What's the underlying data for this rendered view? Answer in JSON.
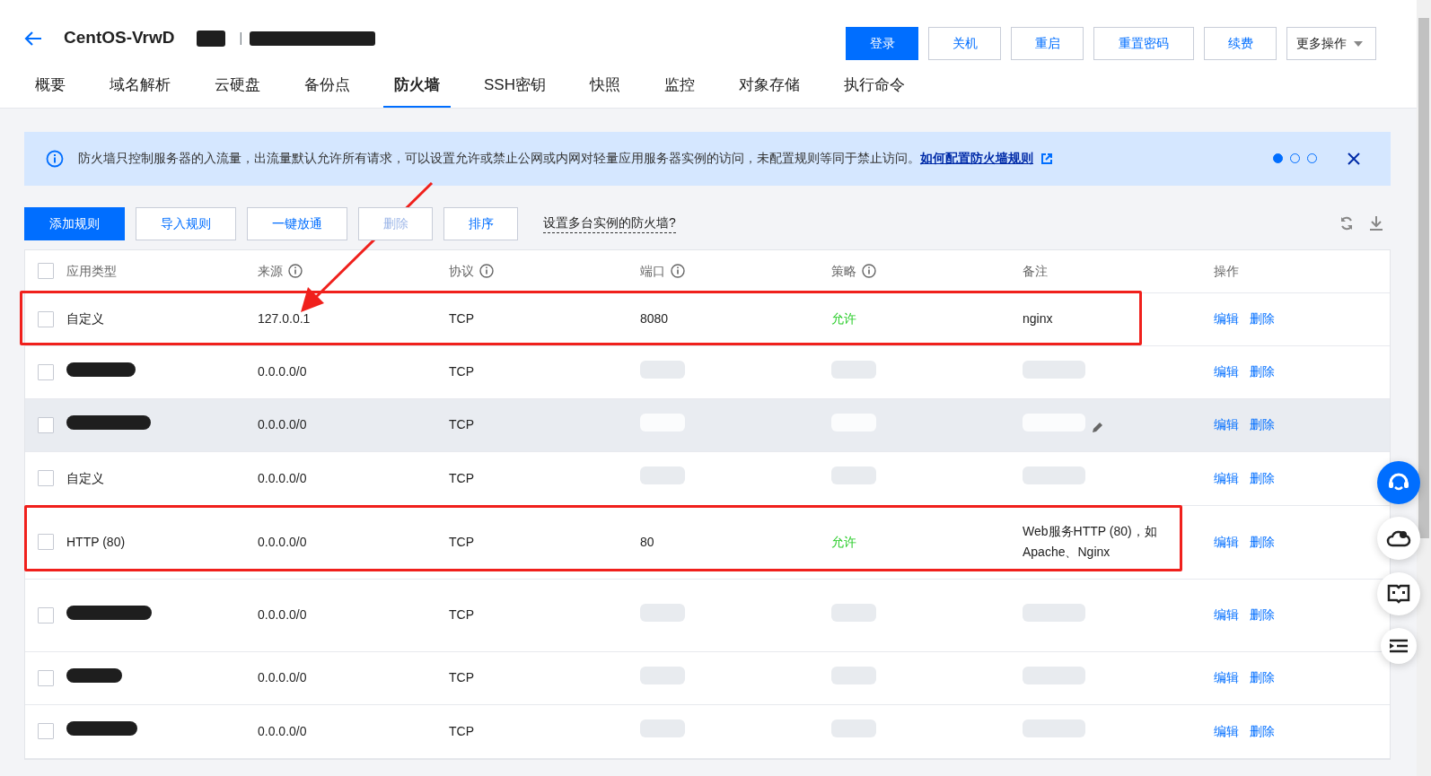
{
  "header": {
    "title": "CentOS-VrwD",
    "separator": "|",
    "name_redacted": true,
    "buttons": [
      {
        "label": "登录",
        "primary": true
      },
      {
        "label": "关机",
        "primary": false
      },
      {
        "label": "重启",
        "primary": false
      },
      {
        "label": "重置密码",
        "primary": false
      },
      {
        "label": "续费",
        "primary": false
      }
    ],
    "more_menu": "更多操作"
  },
  "tabs": [
    {
      "label": "概要",
      "selected": false
    },
    {
      "label": "域名解析",
      "selected": false
    },
    {
      "label": "云硬盘",
      "selected": false
    },
    {
      "label": "备份点",
      "selected": false
    },
    {
      "label": "防火墙",
      "selected": true
    },
    {
      "label": "SSH密钥",
      "selected": false
    },
    {
      "label": "快照",
      "selected": false
    },
    {
      "label": "监控",
      "selected": false
    },
    {
      "label": "对象存储",
      "selected": false
    },
    {
      "label": "执行命令",
      "selected": false
    }
  ],
  "notice": {
    "text": "防火墙只控制服务器的入流量，出流量默认允许所有请求，可以设置允许或禁止公网或内网对轻量应用服务器实例的访问，未配置规则等同于禁止访问。",
    "link": "如何配置防火墙规则",
    "pages": [
      {
        "selected": true
      },
      {
        "selected": false
      },
      {
        "selected": false
      }
    ]
  },
  "toolbar": {
    "buttons": [
      {
        "label": "添加规则",
        "primary": true,
        "disabled": false
      },
      {
        "label": "导入规则",
        "primary": false,
        "disabled": false
      },
      {
        "label": "一键放通",
        "primary": false,
        "disabled": false
      },
      {
        "label": "删除",
        "primary": false,
        "disabled": true
      },
      {
        "label": "排序",
        "primary": false,
        "disabled": false
      }
    ],
    "help_link": "设置多台实例的防火墙?"
  },
  "table": {
    "all_checked": false,
    "columns": [
      {
        "label": "应用类型",
        "info": false
      },
      {
        "label": "来源",
        "info": true
      },
      {
        "label": "协议",
        "info": true
      },
      {
        "label": "端口",
        "info": true
      },
      {
        "label": "策略",
        "info": true
      },
      {
        "label": "备注",
        "info": false
      },
      {
        "label": "操作",
        "info": false
      }
    ],
    "rows": [
      {
        "type": "自定义",
        "type_redacted": false,
        "source": "127.0.0.1",
        "protocol": "TCP",
        "port": "8080",
        "policy": "允许",
        "note": "nginx",
        "blurred": false,
        "checked": false,
        "hovered": false,
        "highlighted": true,
        "pointed": true,
        "actions": [
          "编辑",
          "删除"
        ]
      },
      {
        "type_redacted": true,
        "source": "0.0.0.0/0",
        "protocol": "TCP",
        "blurred": true,
        "checked": false,
        "hovered": false,
        "highlighted": false,
        "pointed": false,
        "actions": [
          "编辑",
          "删除"
        ]
      },
      {
        "type_redacted": true,
        "source": "0.0.0.0/0",
        "protocol": "TCP",
        "blurred": true,
        "checked": false,
        "hovered": true,
        "highlighted": false,
        "pointed": false,
        "actions": [
          "编辑",
          "删除"
        ]
      },
      {
        "type": "自定义",
        "type_redacted": false,
        "source": "0.0.0.0/0",
        "protocol": "TCP",
        "blurred": true,
        "checked": false,
        "hovered": false,
        "highlighted": false,
        "pointed": false,
        "actions": [
          "编辑",
          "删除"
        ]
      },
      {
        "type": "HTTP (80)",
        "type_redacted": false,
        "source": "0.0.0.0/0",
        "protocol": "TCP",
        "port": "80",
        "policy": "允许",
        "note": "Web服务HTTP (80)，如Apache、Nginx",
        "blurred": false,
        "checked": false,
        "hovered": false,
        "highlighted": true,
        "pointed": false,
        "actions": [
          "编辑",
          "删除"
        ]
      },
      {
        "type_redacted": true,
        "source": "0.0.0.0/0",
        "protocol": "TCP",
        "blurred": true,
        "checked": false,
        "hovered": false,
        "highlighted": false,
        "pointed": false,
        "actions": [
          "编辑",
          "删除"
        ]
      },
      {
        "type_redacted": true,
        "source": "0.0.0.0/0",
        "protocol": "TCP",
        "blurred": true,
        "checked": false,
        "hovered": false,
        "highlighted": false,
        "pointed": false,
        "actions": [
          "编辑",
          "删除"
        ]
      },
      {
        "type_redacted": true,
        "source": "0.0.0.0/0",
        "protocol": "TCP",
        "blurred": true,
        "checked": false,
        "hovered": false,
        "highlighted": false,
        "pointed": false,
        "actions": [
          "编辑",
          "删除"
        ]
      }
    ]
  }
}
